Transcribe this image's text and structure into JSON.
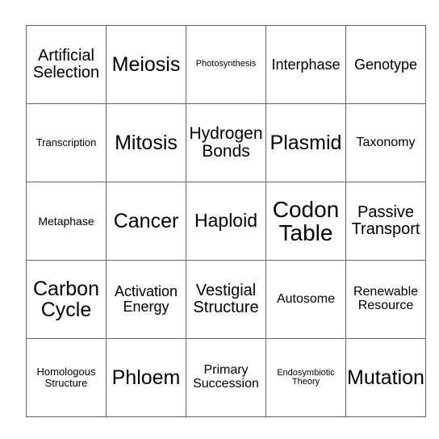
{
  "card": {
    "type": "bingo-card",
    "rows": 5,
    "columns": 5,
    "border_color": "#636363",
    "background_color": "#ffffff",
    "text_color": "#000000",
    "cells": [
      [
        {
          "label": "Artificial\nSelection",
          "size": "fs-l"
        },
        {
          "label": "Meiosis",
          "size": "fs-x3"
        },
        {
          "label": "Photosynthesis",
          "size": "fs-xxs"
        },
        {
          "label": "Interphase",
          "size": "fs-ml"
        },
        {
          "label": "Genotype",
          "size": "fs-ml"
        }
      ],
      [
        {
          "label": "Transcription",
          "size": "fs-xs"
        },
        {
          "label": "Mitosis",
          "size": "fs-x3"
        },
        {
          "label": "Hydrogen\nBonds",
          "size": "fs-xl"
        },
        {
          "label": "Plasmid",
          "size": "fs-x3"
        },
        {
          "label": "Taxonomy",
          "size": "fs-m"
        }
      ],
      [
        {
          "label": "Metaphase",
          "size": "fs-s"
        },
        {
          "label": "Cancer",
          "size": "fs-x3"
        },
        {
          "label": "Haploid",
          "size": "fs-x2"
        },
        {
          "label": "Codon\nTable",
          "size": "fs-x4"
        },
        {
          "label": "Passive\nTransport",
          "size": "fs-l"
        }
      ],
      [
        {
          "label": "Carbon\nCycle",
          "size": "fs-x3"
        },
        {
          "label": "Activation\nEnergy",
          "size": "fs-ml"
        },
        {
          "label": "Vestigial\nStructure",
          "size": "fs-l"
        },
        {
          "label": "Autosome",
          "size": "fs-m"
        },
        {
          "label": "Renewable\nResource",
          "size": "fs-m"
        }
      ],
      [
        {
          "label": "Homologous\nStructure",
          "size": "fs-xs"
        },
        {
          "label": "Phloem",
          "size": "fs-x3"
        },
        {
          "label": "Primary\nSuccession",
          "size": "fs-m"
        },
        {
          "label": "Endosymbiotic\nTheory",
          "size": "fs-xxs"
        },
        {
          "label": "Mutation",
          "size": "fs-x3"
        }
      ]
    ]
  }
}
